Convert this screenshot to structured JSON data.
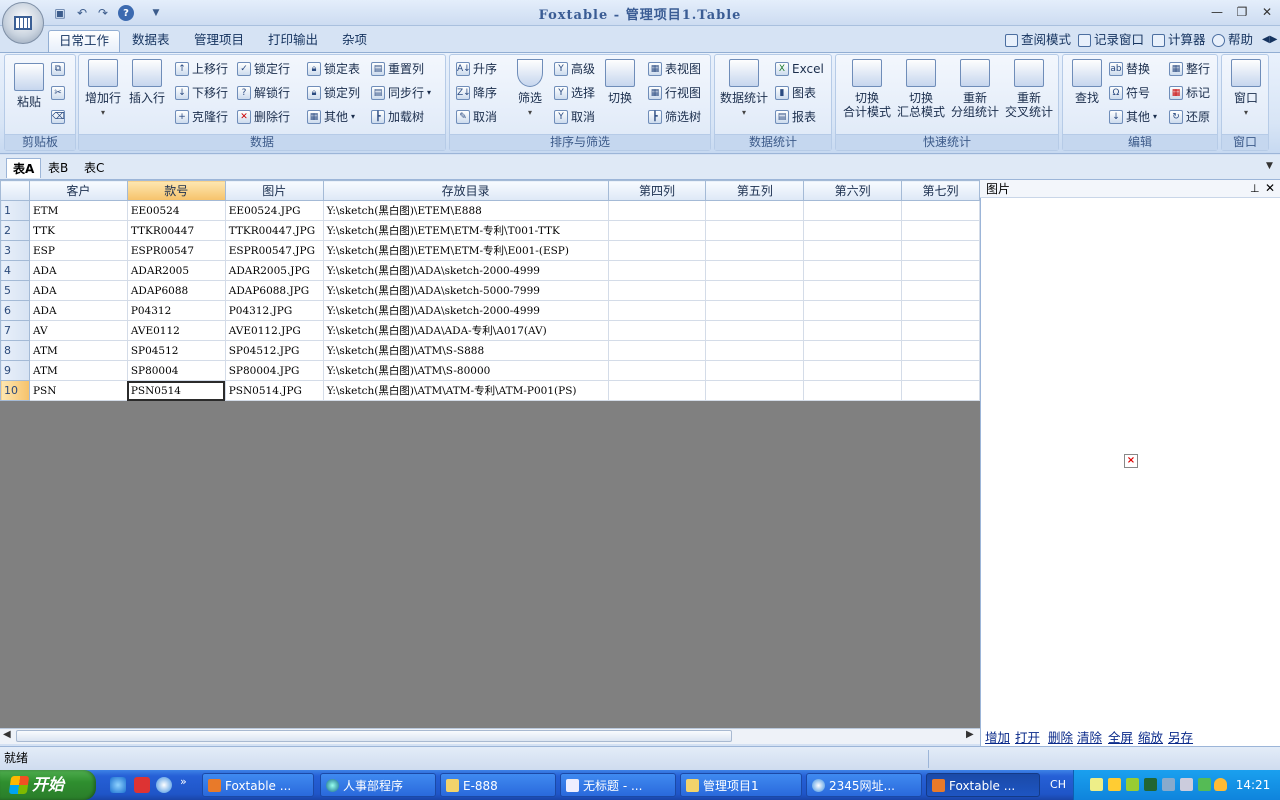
{
  "window": {
    "title": "Foxtable - 管理项目1.Table"
  },
  "ribbon": {
    "tabs": [
      "日常工作",
      "数据表",
      "管理项目",
      "打印输出",
      "杂项"
    ],
    "active_tab": "日常工作",
    "top_links": [
      "查阅模式",
      "记录窗口",
      "计算器",
      "帮助"
    ],
    "groups": {
      "clipboard": {
        "label": "剪贴板",
        "paste": "粘贴"
      },
      "data": {
        "label": "数据",
        "add_row": "增加行",
        "insert_row": "插入行",
        "move_up": "上移行",
        "move_down": "下移行",
        "clone_row": "克隆行",
        "lock_row": "锁定行",
        "unlock_row": "解锁行",
        "delete_row": "删除行",
        "lock_table": "锁定表",
        "lock_col": "锁定列",
        "other": "其他",
        "reset_col": "重置列",
        "sync_row": "同步行",
        "load_tree": "加载树"
      },
      "sort": {
        "label": "排序与筛选",
        "asc": "升序",
        "desc": "降序",
        "cancel": "取消",
        "filter": "筛选",
        "advanced": "高级",
        "select": "选择",
        "cancel2": "取消",
        "toggle": "切换",
        "table_view": "表视图",
        "row_view": "行视图",
        "filter_tree": "筛选树"
      },
      "stats": {
        "label": "数据统计",
        "data_stats": "数据统计",
        "excel": "Excel",
        "chart": "图表",
        "report": "报表"
      },
      "quick": {
        "label": "快速统计",
        "b1a": "切换",
        "b1b": "合计模式",
        "b2a": "切换",
        "b2b": "汇总模式",
        "b3a": "重新",
        "b3b": "分组统计",
        "b4a": "重新",
        "b4b": "交叉统计"
      },
      "edit": {
        "label": "编辑",
        "find": "查找",
        "replace": "替换",
        "symbol": "符号",
        "other": "其他",
        "whole_row": "整行",
        "mark": "标记",
        "restore": "还原"
      },
      "window": {
        "label": "窗口",
        "window": "窗口"
      }
    }
  },
  "sheet_tabs": [
    "表A",
    "表B",
    "表C"
  ],
  "grid": {
    "columns": [
      "客户",
      "款号",
      "图片",
      "存放目录",
      "第四列",
      "第五列",
      "第六列",
      "第七列"
    ],
    "rows": [
      [
        "1",
        "ETM",
        "EE00524",
        "EE00524.JPG",
        "Y:\\sketch(黑白图)\\ETEM\\E888"
      ],
      [
        "2",
        "TTK",
        "TTKR00447",
        "TTKR00447.JPG",
        "Y:\\sketch(黑白图)\\ETEM\\ETM-专利\\T001-TTK"
      ],
      [
        "3",
        "ESP",
        "ESPR00547",
        "ESPR00547.JPG",
        "Y:\\sketch(黑白图)\\ETEM\\ETM-专利\\E001-(ESP)"
      ],
      [
        "4",
        "ADA",
        "ADAR2005",
        "ADAR2005.JPG",
        "Y:\\sketch(黑白图)\\ADA\\sketch-2000-4999"
      ],
      [
        "5",
        "ADA",
        "ADAP6088",
        "ADAP6088.JPG",
        "Y:\\sketch(黑白图)\\ADA\\sketch-5000-7999"
      ],
      [
        "6",
        "ADA",
        "P04312",
        "P04312.JPG",
        "Y:\\sketch(黑白图)\\ADA\\sketch-2000-4999"
      ],
      [
        "7",
        "AV",
        "AVE0112",
        "AVE0112.JPG",
        "Y:\\sketch(黑白图)\\ADA\\ADA-专利\\A017(AV)"
      ],
      [
        "8",
        "ATM",
        "SP04512",
        "SP04512.JPG",
        "Y:\\sketch(黑白图)\\ATM\\S-S888"
      ],
      [
        "9",
        "ATM",
        "SP80004",
        "SP80004.JPG",
        "Y:\\sketch(黑白图)\\ATM\\S-80000"
      ],
      [
        "10",
        "PSN",
        "PSN0514",
        "PSN0514.JPG",
        "Y:\\sketch(黑白图)\\ATM\\ATM-专利\\ATM-P001(PS)"
      ]
    ]
  },
  "panel": {
    "title": "图片",
    "links": [
      "增加",
      "打开",
      "删除",
      "清除",
      "全屏",
      "缩放",
      "另存"
    ]
  },
  "status": {
    "text": "就绪"
  },
  "taskbar": {
    "start": "开始",
    "items": [
      "Foxtable ...",
      "人事部程序",
      "E-888",
      "无标题 - ...",
      "管理项目1",
      "2345网址...",
      "Foxtable ..."
    ],
    "ime": "CH",
    "clock": "14:21"
  },
  "colors": {
    "accent": "#f6c26a",
    "ribbon": "#d8e5f6",
    "taskbar": "#2660d6"
  }
}
